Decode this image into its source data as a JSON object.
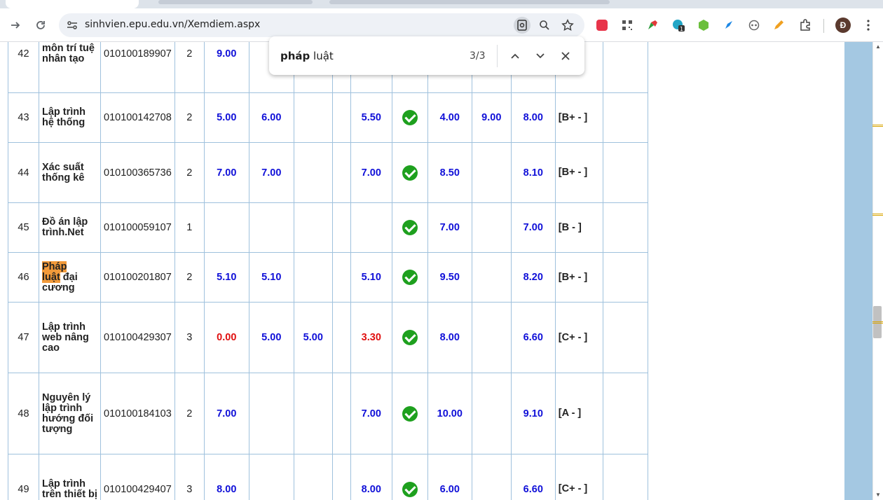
{
  "browser": {
    "url": "sinhvien.epu.edu.vn/Xemdiem.aspx",
    "profile_initial": "Đ"
  },
  "find_bar": {
    "query_bold": "pháp",
    "query_rest": " luật",
    "count": "3/3"
  },
  "colors": {
    "grade_blue": "#1010d8",
    "grade_red": "#e01010",
    "border": "#9fc1dd",
    "highlight": "#f29a3a",
    "pass_check": "#1ea01e"
  },
  "rows": [
    {
      "stt": "42",
      "name": "môn trí tuệ nhân tạo",
      "code": "010100189907",
      "credits": "2",
      "g1": "9.00",
      "g2": "",
      "g3": "",
      "g4": "",
      "g5": "",
      "exam": "",
      "g7": "",
      "final": "",
      "letter": "[B+ -",
      "pass": false
    },
    {
      "stt": "43",
      "name": "Lập trình hệ thống",
      "code": "010100142708",
      "credits": "2",
      "g1": "5.00",
      "g2": "6.00",
      "g3": "",
      "g4": "",
      "g5": "5.50",
      "exam": "4.00",
      "g7": "9.00",
      "final": "8.00",
      "letter": "[B+ - ]",
      "pass": true
    },
    {
      "stt": "44",
      "name": "Xác suất thống kê",
      "code": "010100365736",
      "credits": "2",
      "g1": "7.00",
      "g2": "7.00",
      "g3": "",
      "g4": "",
      "g5": "7.00",
      "exam": "8.50",
      "g7": "",
      "final": "8.10",
      "letter": "[B+ - ]",
      "pass": true
    },
    {
      "stt": "45",
      "name": "Đồ án lập trình.Net",
      "code": "010100059107",
      "credits": "1",
      "g1": "",
      "g2": "",
      "g3": "",
      "g4": "",
      "g5": "",
      "exam": "7.00",
      "g7": "",
      "final": "7.00",
      "letter": "[B - ]",
      "pass": true
    },
    {
      "stt": "46",
      "name_hl_1": "Pháp",
      "name_hl_2": "luật",
      "name_rest": " đại cương",
      "code": "010100201807",
      "credits": "2",
      "g1": "5.10",
      "g2": "5.10",
      "g3": "",
      "g4": "",
      "g5": "5.10",
      "exam": "9.50",
      "g7": "",
      "final": "8.20",
      "letter": "[B+ - ]",
      "pass": true
    },
    {
      "stt": "47",
      "name": "Lập trình web nâng cao",
      "code": "010100429307",
      "credits": "3",
      "g1": "0.00",
      "g2": "5.00",
      "g3": "5.00",
      "g4": "",
      "g5": "3.30",
      "exam": "8.00",
      "g7": "",
      "final": "6.60",
      "letter": "[C+ - ]",
      "pass": true
    },
    {
      "stt": "48",
      "name": "Nguyên lý lập trình hướng đối tượng",
      "code": "010100184103",
      "credits": "2",
      "g1": "7.00",
      "g2": "",
      "g3": "",
      "g4": "",
      "g5": "7.00",
      "exam": "10.00",
      "g7": "",
      "final": "9.10",
      "letter": "[A - ]",
      "pass": true
    },
    {
      "stt": "49",
      "name": "Lập trình trên thiết bị",
      "code": "010100429407",
      "credits": "3",
      "g1": "8.00",
      "g2": "",
      "g3": "",
      "g4": "",
      "g5": "8.00",
      "exam": "6.00",
      "g7": "",
      "final": "6.60",
      "letter": "[C+ - ]",
      "pass": true
    }
  ]
}
